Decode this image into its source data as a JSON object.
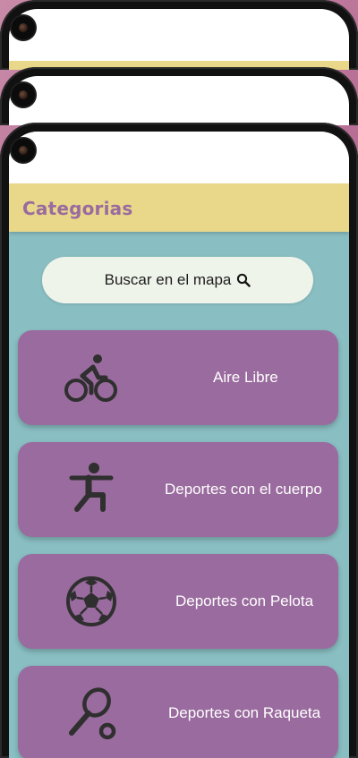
{
  "app_bar": {
    "title": "Categorias"
  },
  "search": {
    "label": "Buscar en el mapa",
    "icon": "search-icon"
  },
  "categories": [
    {
      "label": "Aire Libre",
      "icon": "cyclist-icon"
    },
    {
      "label": "Deportes con el cuerpo",
      "icon": "body-exercise-icon"
    },
    {
      "label": "Deportes con Pelota",
      "icon": "soccer-ball-icon"
    },
    {
      "label": "Deportes con Raqueta",
      "icon": "tennis-racket-icon"
    }
  ],
  "colors": {
    "app_bar": "#e9d88a",
    "title": "#9a6b9e",
    "background": "#89bec2",
    "card": "#9a6b9e",
    "search_button": "#eff4ea",
    "icon": "#2f2f2f"
  }
}
